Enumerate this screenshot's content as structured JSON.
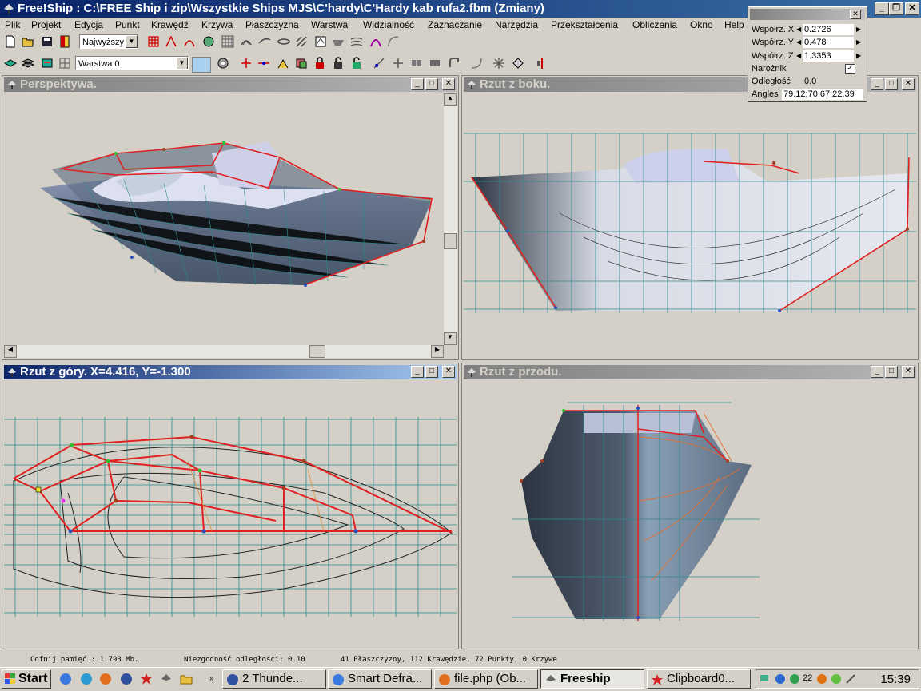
{
  "window": {
    "title": "Free!Ship  : C:\\FREE Ship i zip\\Wszystkie Ships MJS\\C'hardy\\C'Hardy kab rufa2.fbm (Zmiany)",
    "controls": [
      "_",
      "❐",
      "✕"
    ]
  },
  "menu": [
    "Plik",
    "Projekt",
    "Edycja",
    "Punkt",
    "Krawędź",
    "Krzywa",
    "Płaszczyzna",
    "Warstwa",
    "Widzialność",
    "Zaznaczanie",
    "Narzędzia",
    "Przekształcenia",
    "Obliczenia",
    "Okno",
    "Help"
  ],
  "toolbar": {
    "precision": "Najwyższy",
    "layer": "Warstwa 0"
  },
  "coord_panel": {
    "rows": [
      {
        "label": "Współrz. X",
        "value": "0.2726"
      },
      {
        "label": "Współrz. Y",
        "value": "0.478"
      },
      {
        "label": "Współrz. Z",
        "value": "1.3353"
      }
    ],
    "corner_label": "Narożnik",
    "corner_checked": true,
    "distance_label": "Odległość",
    "distance_value": "0.0",
    "angles_label": "Angles",
    "angles_value": "79.12;70.67;22.39"
  },
  "viewports": {
    "perspective": {
      "title": "Perspektywa."
    },
    "side": {
      "title": "Rzut z boku."
    },
    "top": {
      "title": "Rzut z góry.  X=4.416,   Y=-1.300"
    },
    "front": {
      "title": "Rzut z przodu."
    }
  },
  "statusbar": {
    "memory": "Cofnij pamięć : 1.793 Mb.",
    "tolerance": "Niezgodność odległości: 0.10",
    "counts": "41 Płaszczyzny, 112 Krawędzie, 72 Punkty, 0 Krzywe"
  },
  "taskbar": {
    "start": "Start",
    "buttons": [
      "2 Thunde...",
      "Smart Defra...",
      "file.php (Ob...",
      "Freeship",
      "Clipboard0..."
    ],
    "tray_number": "22",
    "clock": "15:39"
  },
  "colors": {
    "hull": "#4d5f73",
    "deck": "#c9cde6",
    "control_net": "#e02020",
    "grid": "#2a8a8a"
  }
}
